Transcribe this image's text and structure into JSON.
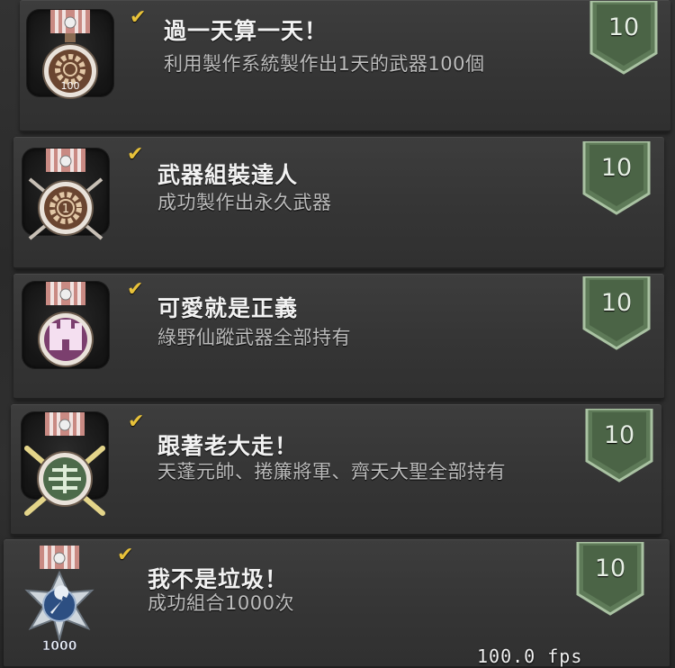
{
  "achievements": [
    {
      "title": "過一天算一天！",
      "description": "利用製作系統製作出1天的武器100個",
      "reward": "10",
      "medal": "gear-100",
      "medal_text": "100"
    },
    {
      "title": "武器組裝達人",
      "description": "成功製作出永久武器",
      "reward": "10",
      "medal": "gear-1",
      "medal_text": "1"
    },
    {
      "title": "可愛就是正義",
      "description": "綠野仙蹤武器全部持有",
      "reward": "10",
      "medal": "castle",
      "medal_text": ""
    },
    {
      "title": "跟著老大走！",
      "description": "天蓬元帥、捲簾將軍、齊天大聖全部持有",
      "reward": "10",
      "medal": "jade-symbol",
      "medal_text": ""
    },
    {
      "title": "我不是垃圾！",
      "description": "成功組合1000次",
      "reward": "10",
      "medal": "wrench-1000",
      "medal_text": "1000"
    }
  ],
  "overlay": {
    "fps": "100.0 fps"
  },
  "colors": {
    "check": "#e8c23a",
    "badge": "#5e7a58",
    "ribbon": "#c98a83"
  }
}
